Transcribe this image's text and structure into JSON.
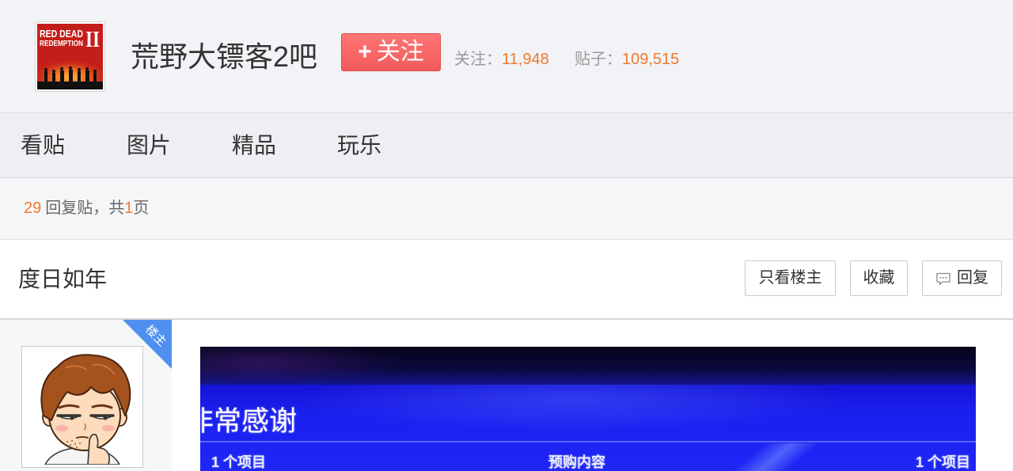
{
  "forum": {
    "name": "荒野大镖客2吧",
    "logo": {
      "line1": "RED DEAD",
      "line2": "REDEMPTION",
      "numeral": "II"
    },
    "follow_button": {
      "icon": "+",
      "label": "关注"
    },
    "stats": {
      "followers": {
        "label": "关注：",
        "value": "11,948"
      },
      "posts": {
        "label": "贴子：",
        "value": "109,515"
      }
    }
  },
  "nav": {
    "items": [
      {
        "label": "看贴"
      },
      {
        "label": "图片"
      },
      {
        "label": "精品"
      },
      {
        "label": "玩乐"
      }
    ]
  },
  "thread_summary": {
    "reply_count": "29",
    "reply_text": "回复贴，共",
    "page_count": "1",
    "page_suffix": "页"
  },
  "thread": {
    "title": "度日如年",
    "actions": {
      "only_op": "只看楼主",
      "favorite": "收藏",
      "reply": "回复",
      "reply_icon": "comment-icon"
    }
  },
  "post": {
    "op_badge": "楼主",
    "image": {
      "headline": "非常感谢",
      "left_label": "1 个项目",
      "center_label": "预购内容",
      "right_label": "1 个项目"
    }
  },
  "colors": {
    "accent_orange": "#f07a2d",
    "follow_red": "#f25a5a",
    "op_badge_blue": "#4f8ff0",
    "screen_blue": "#1a20f0"
  }
}
